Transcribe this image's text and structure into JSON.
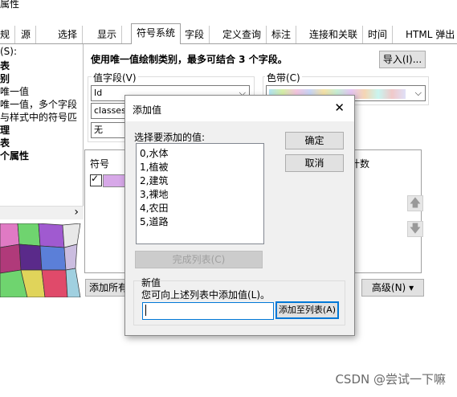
{
  "window": {
    "title": "属性"
  },
  "tabs": [
    "规",
    "源",
    "选择",
    "显示",
    "符号系统",
    "字段",
    "定义查询",
    "标注",
    "连接和关联",
    "时间",
    "HTML 弹出"
  ],
  "left_panel": {
    "header": "(S):",
    "items": [
      "表",
      "别",
      "唯一值",
      "唯一值，多个字段",
      "与样式中的符号匹",
      "理",
      "表",
      "个属性"
    ]
  },
  "main": {
    "description": "使用唯一值绘制类别，最多可结合 3 个字段。",
    "import_button": "导入(I)...",
    "value_field_label": "值字段(V)",
    "fields": [
      "Id",
      "classes",
      "无"
    ],
    "color_ramp_label": "色带(C)",
    "symbol_header": "符号",
    "count_header": "计数",
    "add_all_button": "添加所有",
    "advanced_button": "高级(N)",
    "advanced_arrow": "▾",
    "up_arrow": "🡅",
    "down_arrow": "🡇",
    "scroll_arrow": "›"
  },
  "dialog": {
    "title": "添加值",
    "close": "✕",
    "select_label": "选择要添加的值:",
    "values": [
      "0,水体",
      "1,植被",
      "2,建筑",
      "3,裸地",
      "4,农田",
      "5,道路"
    ],
    "ok_button": "确定",
    "cancel_button": "取消",
    "complete_list_button": "完成列表(C)",
    "new_value_group": "新值",
    "new_value_hint": "您可向上述列表中添加值(L)。",
    "new_value_input": "",
    "add_to_list_button": "添加至列表(A)"
  },
  "watermark": "CSDN @尝试一下嘛"
}
